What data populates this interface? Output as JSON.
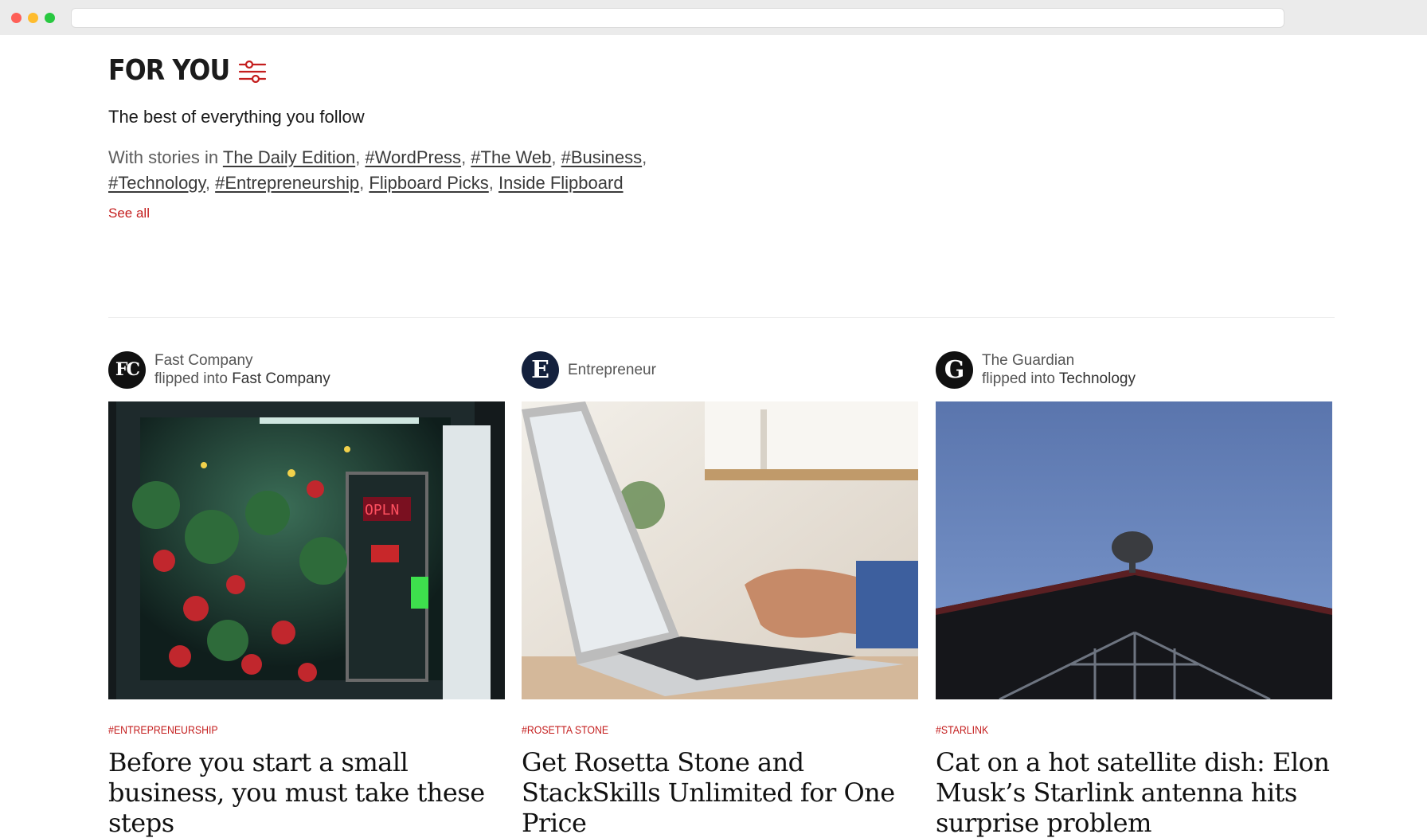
{
  "header": {
    "title": "FOR YOU",
    "subtitle": "The best of everything you follow",
    "stories_prefix": "With stories in",
    "topics": [
      "The Daily Edition",
      "#WordPress",
      "#The Web",
      "#Business",
      "#Technology",
      "#Entrepreneurship",
      "Flipboard Picks",
      "Inside Flipboard"
    ],
    "see_all": "See all"
  },
  "colors": {
    "accent": "#c41e1e"
  },
  "cards": [
    {
      "source": "Fast Company",
      "flipped_prefix": "flipped into",
      "flipped_into": "Fast Company",
      "avatar_text": "FC",
      "tag": "#ENTREPRENEURSHIP",
      "headline": "Before you start a small business, you must take these steps"
    },
    {
      "source": "Entrepreneur",
      "avatar_text": "E",
      "tag": "#ROSETTA STONE",
      "headline": "Get Rosetta Stone and StackSkills Unlimited for One Price"
    },
    {
      "source": "The Guardian",
      "flipped_prefix": "flipped into",
      "flipped_into": "Technology",
      "avatar_text": "G",
      "tag": "#STARLINK",
      "headline": "Cat on a hot satellite dish: Elon Musk’s Starlink antenna hits surprise problem"
    }
  ]
}
